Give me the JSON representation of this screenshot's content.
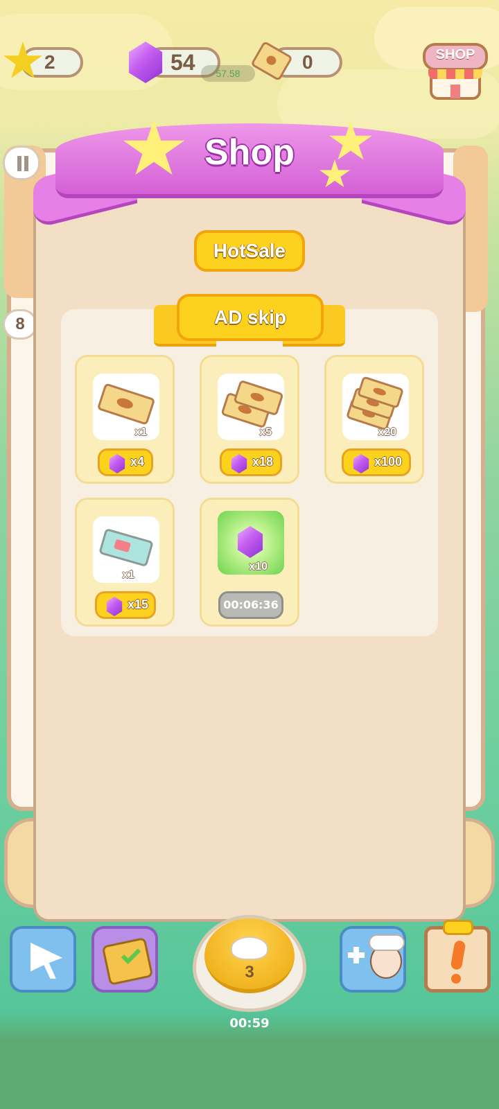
{
  "top_bar": {
    "stars": "2",
    "gems": "54",
    "tickets": "0",
    "shop_button": "SHOP",
    "overlay_text": "57.58"
  },
  "shop": {
    "title": "Shop",
    "tab": "HotSale",
    "section_title": "AD skip",
    "items": [
      {
        "qty": "x1",
        "price": "x4",
        "icon": "ad-ticket-icon"
      },
      {
        "qty": "x5",
        "price": "x18",
        "icon": "ad-ticket-stack-icon"
      },
      {
        "qty": "x20",
        "price": "x100",
        "icon": "ad-ticket-pile-icon"
      },
      {
        "qty": "x1",
        "price": "x15",
        "icon": "blue-ticket-icon"
      },
      {
        "qty": "x10",
        "timer": "00:06:36",
        "icon": "free-gem-icon"
      }
    ]
  },
  "side": {
    "level_badge": "8"
  },
  "bottom_bar": {
    "cook_count": "3",
    "cook_timer": "00:59"
  },
  "colors": {
    "ribbon": "#d461d6",
    "button_yellow": "#fcd21e",
    "panel": "#f2dfc5",
    "gem": "#c45cf0"
  }
}
